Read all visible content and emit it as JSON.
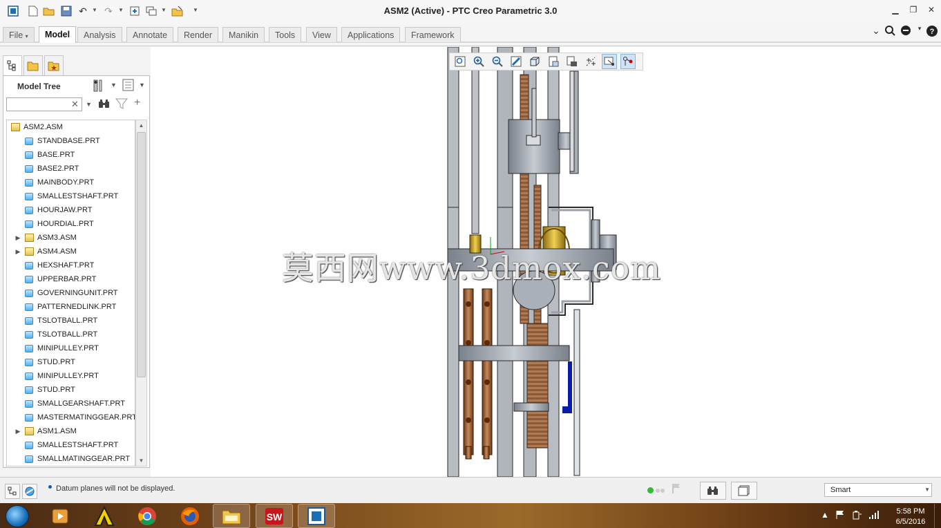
{
  "window": {
    "title": "ASM2 (Active) - PTC Creo Parametric 3.0",
    "controls": [
      "minimize",
      "restore",
      "close"
    ]
  },
  "quick_access": {
    "icons": [
      "app-icon",
      "new-icon",
      "open-icon",
      "save-icon",
      "undo-icon",
      "redo-icon",
      "regenerate-icon",
      "windows-icon",
      "close-window-icon",
      "customize-icon"
    ]
  },
  "ribbon": {
    "tabs": [
      {
        "label": "File",
        "id": "file",
        "dropdown": true
      },
      {
        "label": "Model",
        "id": "model",
        "active": true
      },
      {
        "label": "Analysis",
        "id": "analysis"
      },
      {
        "label": "Annotate",
        "id": "annotate"
      },
      {
        "label": "Render",
        "id": "render"
      },
      {
        "label": "Manikin",
        "id": "manikin"
      },
      {
        "label": "Tools",
        "id": "tools"
      },
      {
        "label": "View",
        "id": "view"
      },
      {
        "label": "Applications",
        "id": "applications"
      },
      {
        "label": "Framework",
        "id": "framework"
      }
    ],
    "right_icons": [
      "collapse-ribbon-icon",
      "search-icon",
      "community-icon",
      "help-icon"
    ]
  },
  "model_tree": {
    "header": "Model Tree",
    "search_placeholder": "",
    "nodes": [
      {
        "label": "ASM2.ASM",
        "type": "assembly",
        "level": 0,
        "expandable": false
      },
      {
        "label": "STANDBASE.PRT",
        "type": "part",
        "level": 1
      },
      {
        "label": "BASE.PRT",
        "type": "part",
        "level": 1
      },
      {
        "label": "BASE2.PRT",
        "type": "part",
        "level": 1
      },
      {
        "label": "MAINBODY.PRT",
        "type": "part",
        "level": 1
      },
      {
        "label": "SMALLESTSHAFT.PRT",
        "type": "part",
        "level": 1
      },
      {
        "label": "HOURJAW.PRT",
        "type": "part",
        "level": 1
      },
      {
        "label": "HOURDIAL.PRT",
        "type": "part",
        "level": 1
      },
      {
        "label": "ASM3.ASM",
        "type": "assembly",
        "level": 1,
        "expandable": true
      },
      {
        "label": "ASM4.ASM",
        "type": "assembly",
        "level": 1,
        "expandable": true
      },
      {
        "label": "HEXSHAFT.PRT",
        "type": "part",
        "level": 1
      },
      {
        "label": "UPPERBAR.PRT",
        "type": "part",
        "level": 1
      },
      {
        "label": "GOVERNINGUNIT.PRT",
        "type": "part",
        "level": 1
      },
      {
        "label": "PATTERNEDLINK.PRT",
        "type": "part",
        "level": 1
      },
      {
        "label": "TSLOTBALL.PRT",
        "type": "part",
        "level": 1
      },
      {
        "label": "TSLOTBALL.PRT",
        "type": "part",
        "level": 1
      },
      {
        "label": "MINIPULLEY.PRT",
        "type": "part",
        "level": 1
      },
      {
        "label": "STUD.PRT",
        "type": "part",
        "level": 1
      },
      {
        "label": "MINIPULLEY.PRT",
        "type": "part",
        "level": 1
      },
      {
        "label": "STUD.PRT",
        "type": "part",
        "level": 1
      },
      {
        "label": "SMALLGEARSHAFT.PRT",
        "type": "part",
        "level": 1
      },
      {
        "label": "MASTERMATINGGEAR.PRT",
        "type": "part",
        "level": 1
      },
      {
        "label": "ASM1.ASM",
        "type": "assembly",
        "level": 1,
        "expandable": true
      },
      {
        "label": "SMALLESTSHAFT.PRT",
        "type": "part",
        "level": 1
      },
      {
        "label": "SMALLMATINGGEAR.PRT",
        "type": "part",
        "level": 1
      }
    ]
  },
  "graphics_toolbar": {
    "icons": [
      "refit-icon",
      "zoom-in-icon",
      "zoom-out-icon",
      "repaint-icon",
      "display-style-icon",
      "saved-orientations-icon",
      "view-manager-icon",
      "datum-display-icon",
      "spin-center-icon",
      "annotation-display-icon"
    ]
  },
  "watermark": "莫西网www.3dmox.com",
  "status": {
    "message": "Datum planes will not be displayed.",
    "selection_filter": "Smart"
  },
  "taskbar": {
    "apps": [
      "windows-explorer",
      "media-player",
      "autocad",
      "chrome",
      "firefox",
      "file-explorer",
      "solidworks",
      "creo"
    ],
    "time": "5:58 PM",
    "date": "6/5/2016"
  }
}
